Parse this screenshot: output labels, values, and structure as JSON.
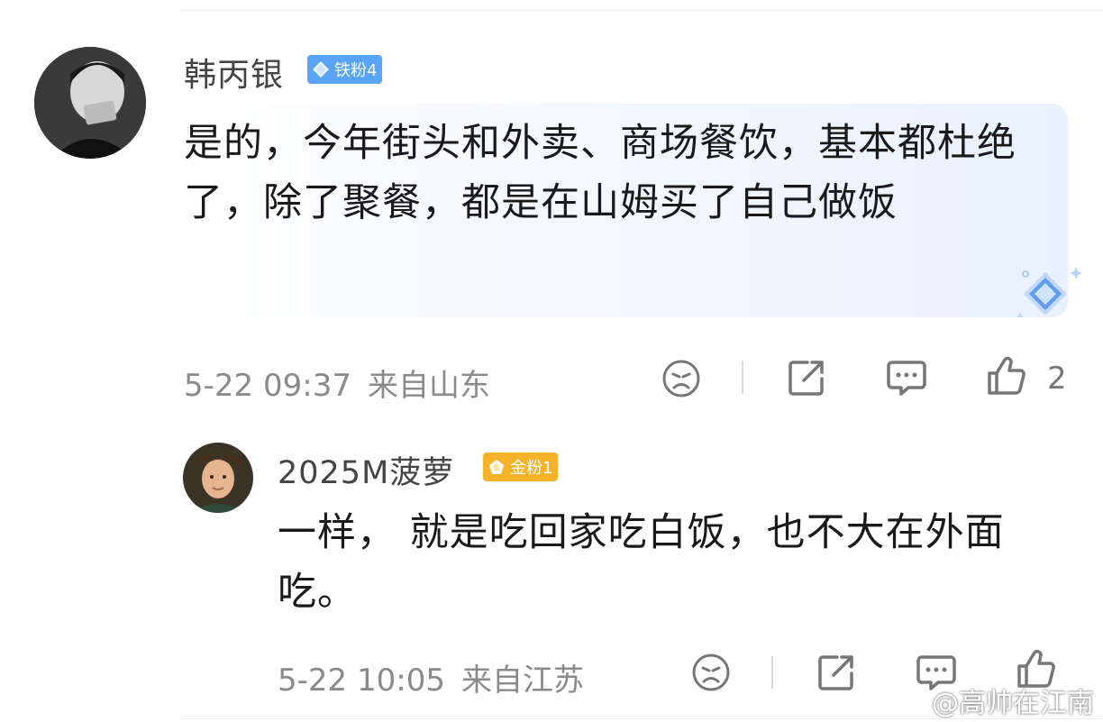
{
  "comment": {
    "username": "韩丙银",
    "badge": "铁粉4",
    "text": "是的，今年街头和外卖、商场餐饮，基本都杜绝了，除了聚餐，都是在山姆买了自己做饭",
    "time": "5-22 09:37",
    "location": "来自山东",
    "like_count": "2",
    "icons": [
      "dislike-icon",
      "share-icon",
      "comment-icon",
      "like-icon"
    ]
  },
  "reply": {
    "username": "2025M菠萝",
    "badge": "金粉1",
    "text": "一样， 就是吃回家吃白饭，也不大在外面吃。",
    "time": "5-22 10:05",
    "location": "来自江苏",
    "icons": [
      "dislike-icon",
      "share-icon",
      "comment-icon",
      "like-icon"
    ]
  },
  "watermark": "@高帅在江南",
  "colors": {
    "badge_iron": "#4f9cf5",
    "badge_gold": "#f5b021",
    "bubble_tint": "#e9f1ff"
  }
}
